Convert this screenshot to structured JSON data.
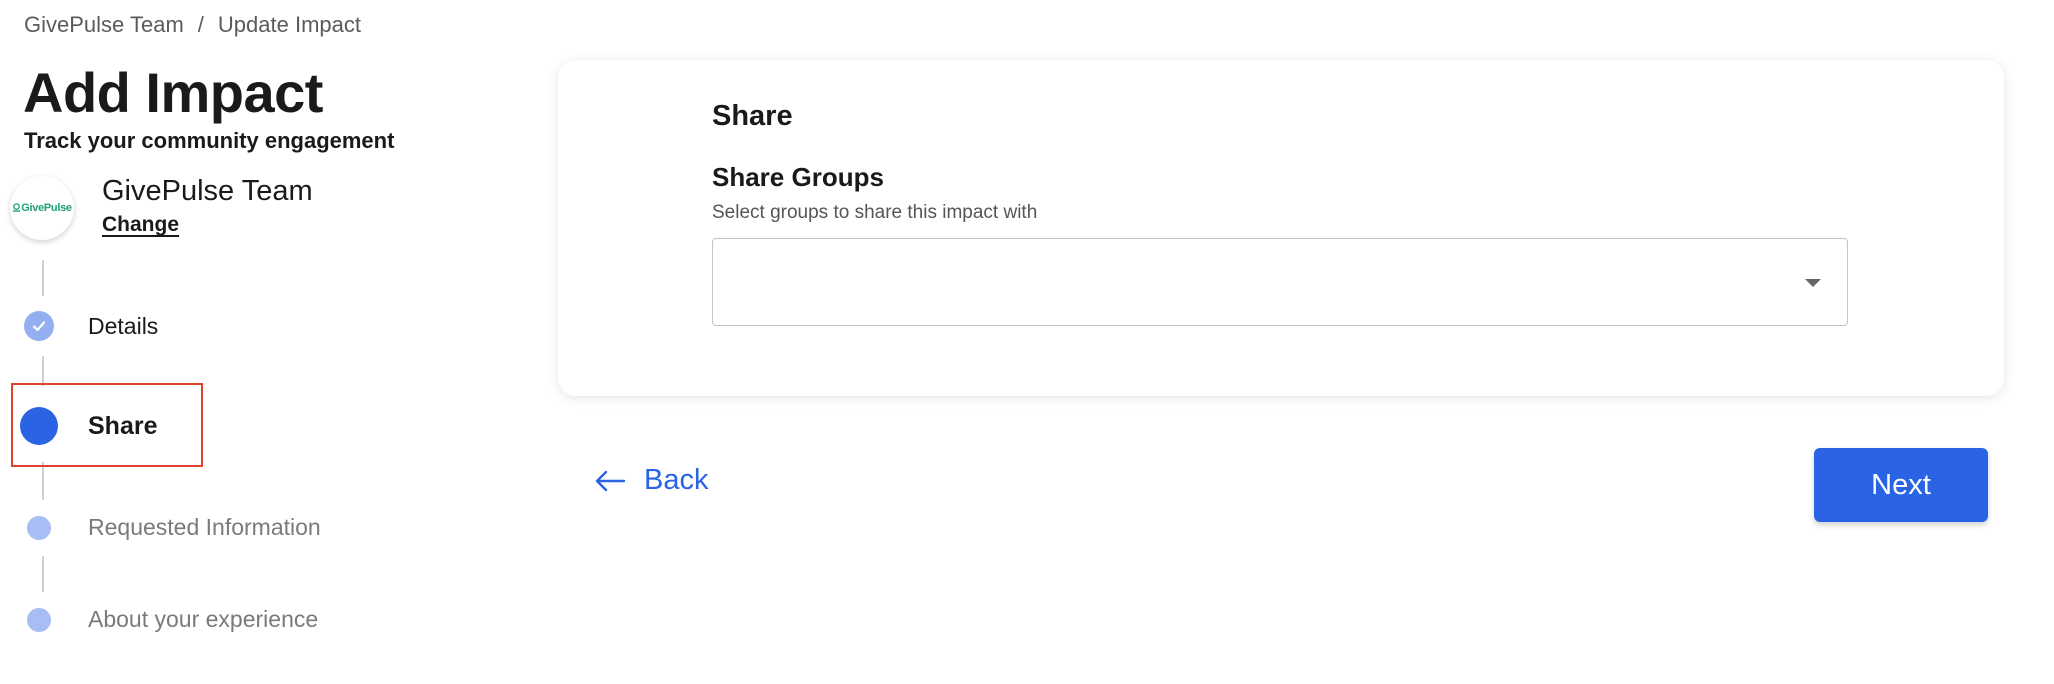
{
  "breadcrumb": {
    "items": [
      "GivePulse Team",
      "Update Impact"
    ],
    "separator": "/"
  },
  "header": {
    "title": "Add Impact",
    "subtitle": "Track your community engagement"
  },
  "organization": {
    "logo_text": "GivePulse",
    "name": "GivePulse Team",
    "change_label": "Change"
  },
  "steps": [
    {
      "label": "Details",
      "state": "done",
      "icon": "check-icon"
    },
    {
      "label": "Share",
      "state": "active"
    },
    {
      "label": "Requested Information",
      "state": "todo"
    },
    {
      "label": "About your experience",
      "state": "todo"
    }
  ],
  "card": {
    "title": "Share",
    "field_label": "Share Groups",
    "field_help": "Select groups to share this impact with",
    "select_value": "",
    "caret_icon": "caret-down-icon"
  },
  "nav": {
    "back_label": "Back",
    "back_icon": "arrow-left-icon",
    "next_label": "Next"
  },
  "colors": {
    "primary": "#2a63e4",
    "step_done": "#93aef1",
    "step_todo": "#a7bdf3",
    "highlight": "#e0432b",
    "logo_green": "#1ea07a"
  }
}
